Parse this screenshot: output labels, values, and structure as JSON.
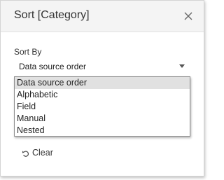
{
  "dialog": {
    "title": "Sort [Category]",
    "close_icon": "close-icon"
  },
  "sort_by": {
    "label": "Sort By",
    "selected": "Data source order",
    "options": [
      "Data source order",
      "Alphabetic",
      "Field",
      "Manual",
      "Nested"
    ]
  },
  "clear": {
    "label": "Clear",
    "icon": "undo-icon"
  },
  "colors": {
    "header_bg": "#f4f4f4",
    "selected_option_bg": "#e1e1e1"
  }
}
